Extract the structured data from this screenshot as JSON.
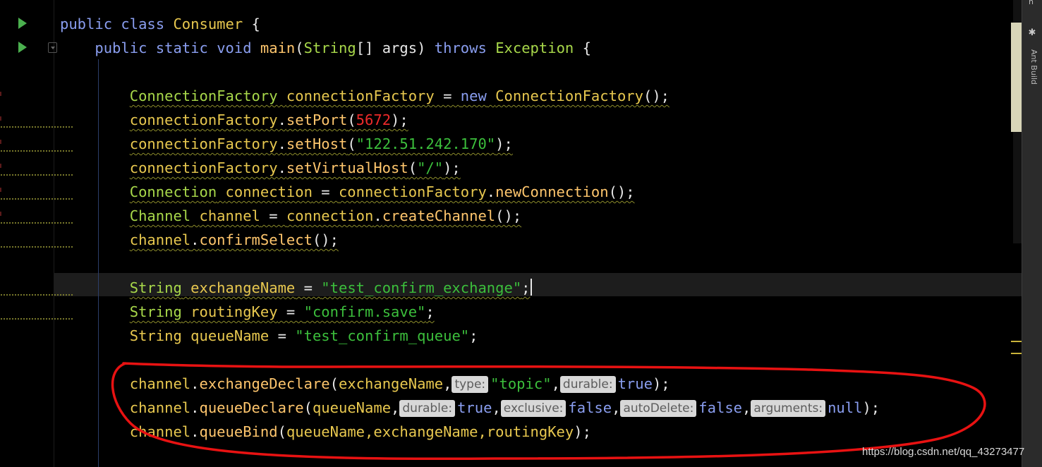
{
  "editor": {
    "lines": {
      "l1": {
        "kw1": "public",
        "kw2": "class",
        "cls": "Consumer",
        "brace": " {"
      },
      "l2": {
        "kw1": "public",
        "kw2": "static",
        "kw3": "void",
        "mth": "main",
        "p1": "(",
        "cls": "String",
        "p2": "[] args) ",
        "kw4": "throws",
        "exc": "Exception",
        "brace": " {"
      },
      "l4": {
        "cls": "ConnectionFactory",
        "var": "connectionFactory",
        "eq": " = ",
        "kw": "new",
        "cls2": "ConnectionFactory",
        "end": "();"
      },
      "l5": {
        "var": "connectionFactory",
        "dot": ".",
        "mth": "setPort",
        "p1": "(",
        "num": "5672",
        "end": ");"
      },
      "l6": {
        "var": "connectionFactory",
        "dot": ".",
        "mth": "setHost",
        "p1": "(",
        "str": "\"122.51.242.170\"",
        "end": ");"
      },
      "l7": {
        "var": "connectionFactory",
        "dot": ".",
        "mth": "setVirtualHost",
        "p1": "(",
        "str": "\"/\"",
        "end": ");"
      },
      "l8": {
        "cls": "Connection",
        "var": "connection",
        "eq": " = ",
        "var2": "connectionFactory",
        "dot": ".",
        "mth": "newConnection",
        "end": "();"
      },
      "l9": {
        "cls": "Channel",
        "var": "channel",
        "eq": " = ",
        "var2": "connection",
        "dot": ".",
        "mth": "createChannel",
        "end": "();"
      },
      "l10": {
        "var": "channel",
        "dot": ".",
        "mth": "confirmSelect",
        "end": "();"
      },
      "l12": {
        "cls": "String",
        "var": "exchangeName",
        "eq": " = ",
        "str": "\"test_confirm_exchange\"",
        "end": ";"
      },
      "l13": {
        "cls": "String",
        "var": "routingKey",
        "eq": " = ",
        "str": "\"confirm.save\"",
        "end": ";"
      },
      "l14": {
        "cls": "String",
        "var": "queueName",
        "eq": " = ",
        "str": "\"test_confirm_queue\"",
        "end": ";"
      },
      "l16": {
        "var": "channel",
        "dot": ".",
        "mth": "exchangeDeclare",
        "p1": "(",
        "arg1": "exchangeName",
        "c1": ",",
        "hint1": "type:",
        "str": "\"topic\"",
        "c2": ",",
        "hint2": "durable:",
        "kw": "true",
        "end": ");"
      },
      "l17": {
        "var": "channel",
        "dot": ".",
        "mth": "queueDeclare",
        "p1": "(",
        "arg1": "queueName",
        "c1": ",",
        "hint1": "durable:",
        "kw1": "true",
        "c2": ",",
        "hint2": "exclusive:",
        "kw2": "false",
        "c3": ",",
        "hint3": "autoDelete:",
        "kw3": "false",
        "c4": ",",
        "hint4": "arguments:",
        "kw4": "null",
        "end": ");"
      },
      "l18": {
        "var": "channel",
        "dot": ".",
        "mth": "queueBind",
        "p1": "(",
        "args": "queueName,exchangeName,routingKey",
        "end": ");"
      }
    }
  },
  "side_panel": {
    "tab_label": "Ant Build",
    "icon": "ant-icon",
    "top_char": "n"
  },
  "watermark": "https://blog.csdn.net/qq_43273477",
  "colors": {
    "annotation": "#e81212",
    "keyword": "#8a9ef0",
    "string": "#3cbf3c",
    "number": "#ee2a2a"
  }
}
